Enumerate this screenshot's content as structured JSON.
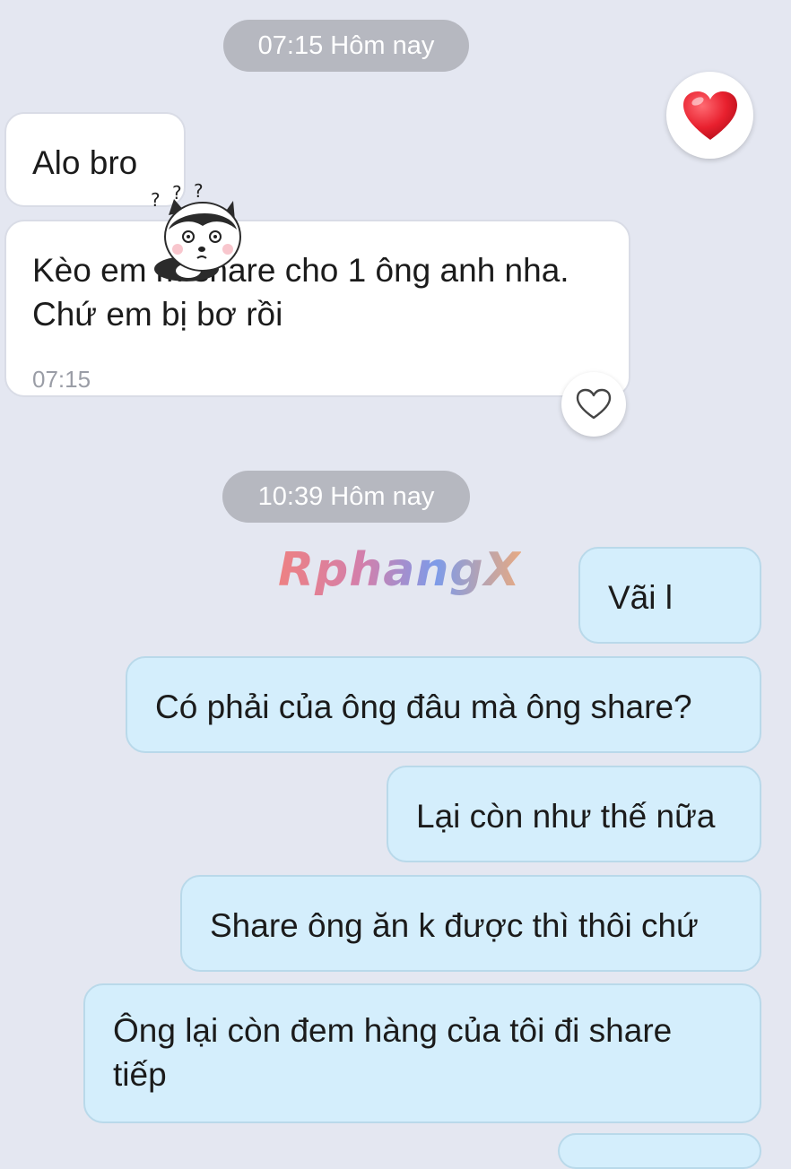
{
  "chat": {
    "divider1": "07:15 Hôm nay",
    "divider2": "10:39 Hôm nay",
    "incoming": [
      {
        "text": "Alo bro"
      },
      {
        "text": "Kèo em m share cho 1 ông anh nha. Chứ em bị bơ rồi",
        "time": "07:15"
      }
    ],
    "outgoing": [
      {
        "text": "Vãi l"
      },
      {
        "text": "Có phải của ông đâu mà ông share?"
      },
      {
        "text": "Lại còn như thế nữa"
      },
      {
        "text": "Share ông ăn k được thì thôi chứ"
      },
      {
        "text": "Ông lại còn đem hàng của tôi đi share tiếp"
      }
    ],
    "reactions": {
      "top_right": "heart-filled-icon",
      "incoming_msg2": "heart-outline-icon"
    },
    "sticker": {
      "icon": "husky-sticker-icon",
      "marks": "? ? ?"
    }
  },
  "watermark": {
    "text": "RphangX"
  },
  "colors": {
    "background": "#e4e7f1",
    "incoming_bubble": "#ffffff",
    "outgoing_bubble": "#d4eefc",
    "divider_pill": "#b6b8c0",
    "heart": "#e8202e"
  }
}
